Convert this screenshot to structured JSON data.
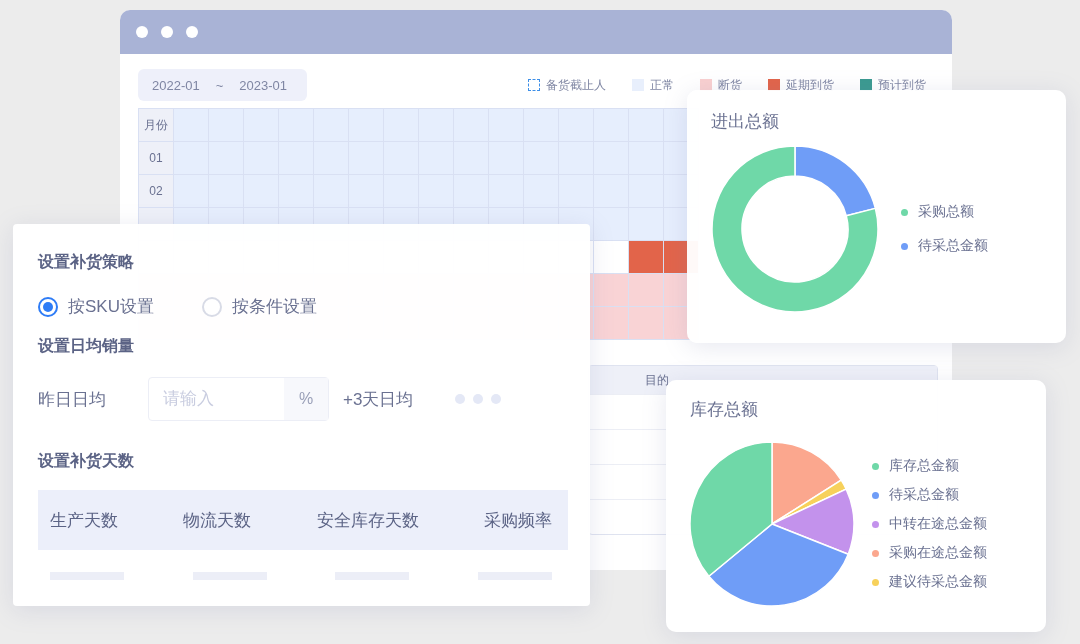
{
  "back_window": {
    "date_range": {
      "start": "2022-01",
      "separator": "~",
      "end": "2023-01"
    },
    "legend": [
      {
        "label": "备货截止人",
        "kind": "dashed",
        "color": "#3d8fe8"
      },
      {
        "label": "正常",
        "kind": "solid",
        "color": "#e8effc"
      },
      {
        "label": "断货",
        "kind": "solid",
        "color": "#f9d0d0"
      },
      {
        "label": "延期到货",
        "kind": "solid",
        "color": "#e2644a"
      },
      {
        "label": "预计到货",
        "kind": "solid",
        "color": "#3a9a90"
      }
    ],
    "grid": {
      "header": "月份",
      "rows": [
        "01",
        "02"
      ]
    },
    "table": {
      "columns": [
        "目的"
      ]
    }
  },
  "strategy_card": {
    "title": "设置补货策略",
    "options": [
      {
        "label": "按SKU设置",
        "selected": true
      },
      {
        "label": "按条件设置",
        "selected": false
      }
    ],
    "sales_title": "设置日均销量",
    "sales_label": "昨日日均",
    "input": {
      "placeholder": "请输入",
      "suffix": "%"
    },
    "sales_next": "+3天日均",
    "days_title": "设置补货天数",
    "days_columns": [
      "生产天数",
      "物流天数",
      "安全库存天数",
      "采购频率"
    ]
  },
  "flow_card": {
    "title": "进出总额",
    "legend": [
      {
        "label": "采购总额",
        "color": "#6fd8a8"
      },
      {
        "label": "待采总金额",
        "color": "#6f9df7"
      }
    ]
  },
  "stock_card": {
    "title": "库存总额",
    "legend": [
      {
        "label": "库存总金额",
        "color": "#6fd8a8"
      },
      {
        "label": "待采总金额",
        "color": "#6f9df7"
      },
      {
        "label": "中转在途总金额",
        "color": "#c392ec"
      },
      {
        "label": "采购在途总金额",
        "color": "#fba78e"
      },
      {
        "label": "建议待采总金额",
        "color": "#f7d15b"
      }
    ]
  }
}
